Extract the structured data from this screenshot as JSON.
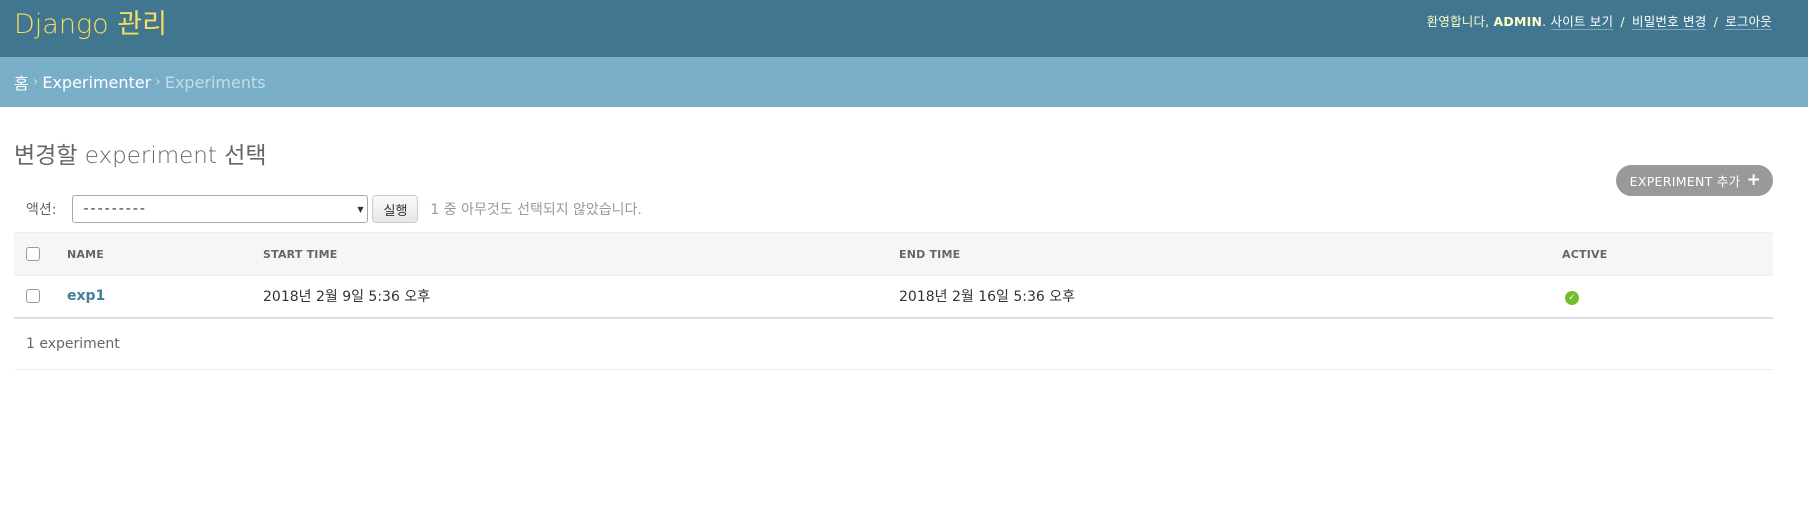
{
  "header": {
    "branding": "Django 관리",
    "welcome": "환영합니다,",
    "username": "admin",
    "view_site": "사이트 보기",
    "change_password": "비밀번호 변경",
    "logout": "로그아웃",
    "separator": "/"
  },
  "breadcrumbs": {
    "home": "홈",
    "app": "Experimenter",
    "current": "Experiments",
    "separator": "›"
  },
  "page": {
    "title": "변경할 experiment 선택",
    "add_button": "EXPERIMENT 추가",
    "add_icon": "+"
  },
  "actions": {
    "label": "액션:",
    "selected_option": "---------",
    "go_button": "실행",
    "counter": "1 중 아무것도 선택되지 않았습니다."
  },
  "table": {
    "columns": [
      "NAME",
      "START TIME",
      "END TIME",
      "ACTIVE"
    ],
    "rows": [
      {
        "name": "exp1",
        "start_time": "2018년 2월 9일 5:36 오후",
        "end_time": "2018년 2월 16일 5:36 오후",
        "active_icon": "check-circle-icon"
      }
    ]
  },
  "paginator": {
    "text": "1 experiment"
  },
  "colors": {
    "header_bg": "#417690",
    "branding": "#f5dd5d",
    "breadcrumbs_bg": "#79aec8",
    "link": "#447e9b",
    "active_green": "#70bf2b"
  }
}
